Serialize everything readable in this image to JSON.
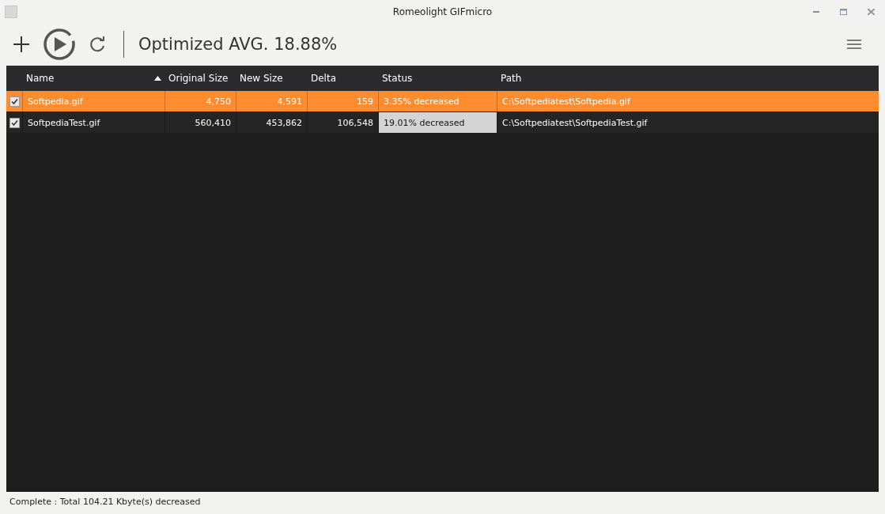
{
  "window": {
    "title": "Romeolight GIFmicro"
  },
  "toolbar": {
    "summary": "Optimized AVG. 18.88%"
  },
  "table": {
    "columns": [
      {
        "label": "Name",
        "sorted": true
      },
      {
        "label": "Original Size",
        "sorted": false
      },
      {
        "label": "New Size",
        "sorted": false
      },
      {
        "label": "Delta",
        "sorted": false
      },
      {
        "label": "Status",
        "sorted": false
      },
      {
        "label": "Path",
        "sorted": false
      }
    ],
    "rows": [
      {
        "checked": true,
        "selected": true,
        "status_focused": false,
        "cells": [
          "Softpedia.gif",
          "4,750",
          "4,591",
          "159",
          "3.35% decreased",
          "C:\\Softpediatest\\Softpedia.gif"
        ]
      },
      {
        "checked": true,
        "selected": false,
        "status_focused": true,
        "cells": [
          "SoftpediaTest.gif",
          "560,410",
          "453,862",
          "106,548",
          "19.01% decreased",
          "C:\\Softpediatest\\SoftpediaTest.gif"
        ]
      }
    ]
  },
  "status_bar": "Complete : Total 104.21 Kbyte(s) decreased"
}
